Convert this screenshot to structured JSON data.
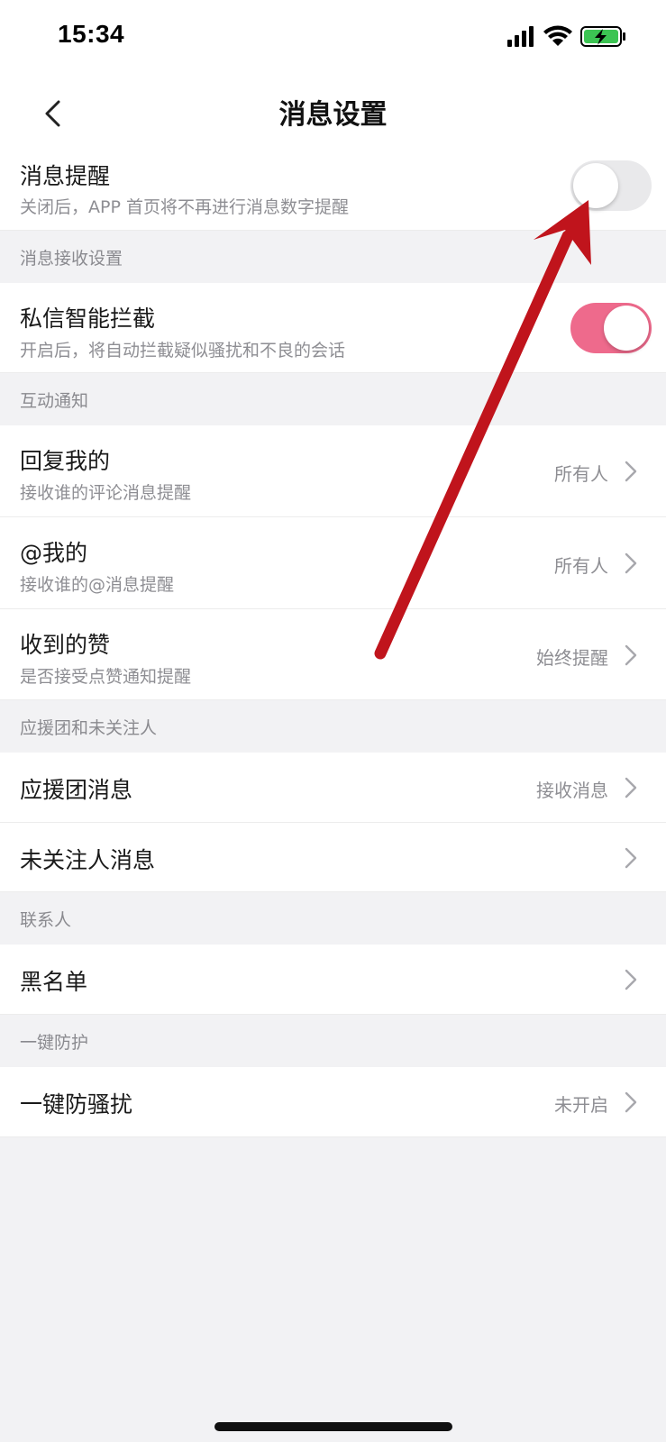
{
  "status_bar": {
    "time": "15:34"
  },
  "header": {
    "title": "消息设置"
  },
  "message_alert": {
    "title": "消息提醒",
    "subtitle": "关闭后，APP 首页将不再进行消息数字提醒",
    "enabled": false
  },
  "sections": {
    "receive": "消息接收设置",
    "interaction": "互动通知",
    "fanclub": "应援团和未关注人",
    "contacts": "联系人",
    "protection": "一键防护"
  },
  "dm_filter": {
    "title": "私信智能拦截",
    "subtitle": "开启后，将自动拦截疑似骚扰和不良的会话",
    "enabled": true
  },
  "reply_me": {
    "title": "回复我的",
    "subtitle": "接收谁的评论消息提醒",
    "value": "所有人"
  },
  "at_me": {
    "title": "@我的",
    "subtitle": "接收谁的@消息提醒",
    "value": "所有人"
  },
  "likes": {
    "title": "收到的赞",
    "subtitle": "是否接受点赞通知提醒",
    "value": "始终提醒"
  },
  "fanclub_msg": {
    "title": "应援团消息",
    "value": "接收消息"
  },
  "stranger_msg": {
    "title": "未关注人消息"
  },
  "blacklist": {
    "title": "黑名单"
  },
  "anti_harass": {
    "title": "一键防骚扰",
    "value": "未开启"
  },
  "colors": {
    "toggle_on": "#ee6a8c",
    "toggle_off": "#e9e9eb",
    "annotation_arrow": "#c0141c",
    "battery": "#3cc453"
  },
  "icons": [
    "back-arrow-icon",
    "chevron-right-icon",
    "signal-icon",
    "wifi-icon",
    "battery-charging-icon"
  ]
}
